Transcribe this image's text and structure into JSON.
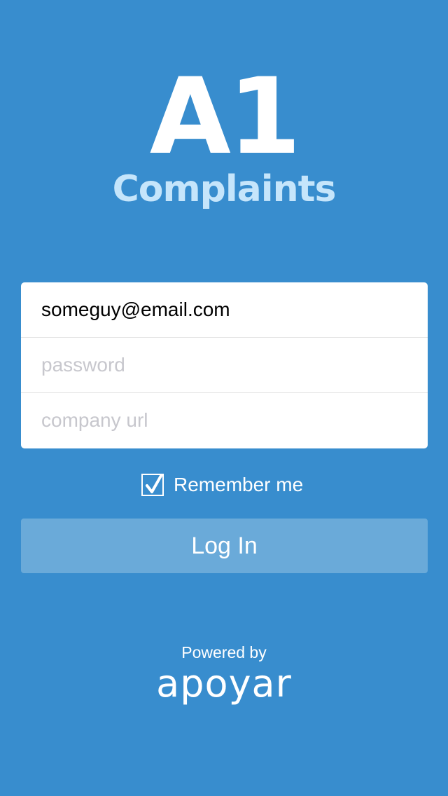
{
  "app": {
    "logo_main": "A1",
    "logo_sub": "Complaints"
  },
  "login_form": {
    "email": {
      "value": "someguy@email.com",
      "placeholder": ""
    },
    "password": {
      "value": "",
      "placeholder": "password"
    },
    "company_url": {
      "value": "",
      "placeholder": "company url"
    },
    "remember_me": {
      "label": "Remember me",
      "checked": true
    },
    "login_button_label": "Log In"
  },
  "footer": {
    "powered_by": "Powered by",
    "brand": "apoyar"
  },
  "colors": {
    "background": "#388dce",
    "logo_sub": "#c5e5fb",
    "button": "#6aaad9",
    "placeholder": "#c7c7cd"
  }
}
